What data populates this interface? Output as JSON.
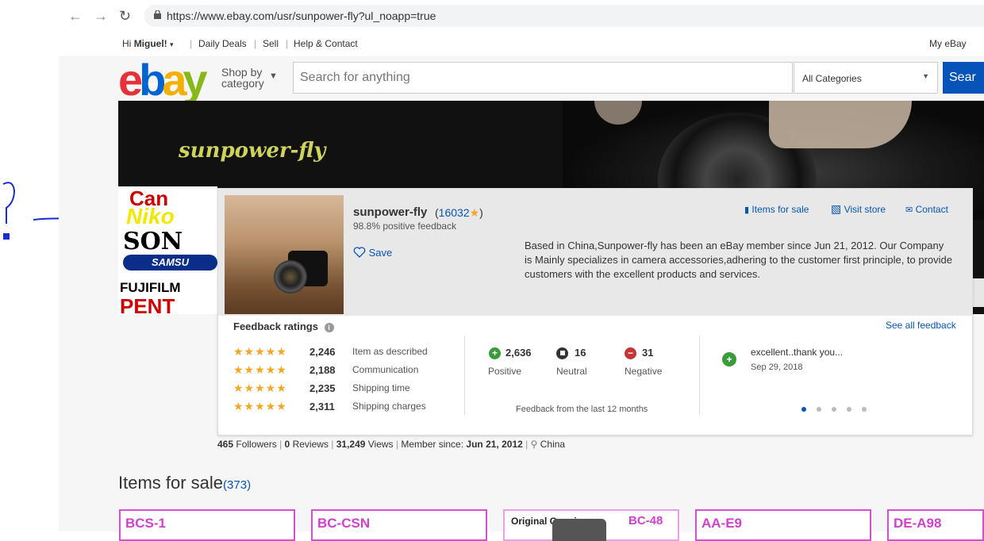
{
  "browser": {
    "url": "https://www.ebay.com/usr/sunpower-fly?ul_noapp=true"
  },
  "topbar": {
    "greeting_prefix": "Hi",
    "user": "Miguel!",
    "daily_deals": "Daily Deals",
    "sell": "Sell",
    "help": "Help & Contact",
    "my_ebay": "My eBay"
  },
  "header": {
    "shop_by_line1": "Shop by",
    "shop_by_line2": "category",
    "search_placeholder": "Search for anything",
    "category_selected": "All Categories",
    "search_button": "Sear"
  },
  "banner": {
    "store_name": "sunpower-fly",
    "brands": [
      "Can",
      "Niko",
      "SON",
      "SAMSU",
      "FUJIFILM",
      "PENT"
    ]
  },
  "seller": {
    "name": "sunpower-fly",
    "score": "16032",
    "positive": "98.8% positive feedback",
    "save": "Save",
    "items_for_sale": "Items for sale",
    "visit_store": "Visit store",
    "contact": "Contact",
    "description": "Based in China,Sunpower-fly has been an eBay member since Jun 21, 2012. Our Company is Mainly specializes in camera accessories,adhering to the customer first principle, to provide customers with the excellent products and services."
  },
  "feedback": {
    "title": "Feedback ratings",
    "see_all": "See all feedback",
    "ratings": [
      {
        "count": "2,246",
        "label": "Item as described"
      },
      {
        "count": "2,188",
        "label": "Communication"
      },
      {
        "count": "2,235",
        "label": "Shipping time"
      },
      {
        "count": "2,311",
        "label": "Shipping charges"
      }
    ],
    "positive_count": "2,636",
    "positive_label": "Positive",
    "neutral_count": "16",
    "neutral_label": "Neutral",
    "negative_count": "31",
    "negative_label": "Negative",
    "period": "Feedback from the last 12 months",
    "comment": "excellent..thank you...",
    "comment_date": "Sep 29, 2018"
  },
  "stats": {
    "followers_num": "465",
    "followers_label": "Followers",
    "reviews_num": "0",
    "reviews_label": "Reviews",
    "views_num": "31,249",
    "views_label": "Views",
    "member_label": "Member since:",
    "member_date": "Jun 21, 2012",
    "location": "China"
  },
  "items": {
    "title": "Items for sale",
    "count": "(373)",
    "thumbs": [
      "BCS-1",
      "BC-CSN",
      "BC-48",
      "AA-E9",
      "DE-A98"
    ],
    "thumb3_prefix": "Original  Genuine"
  }
}
